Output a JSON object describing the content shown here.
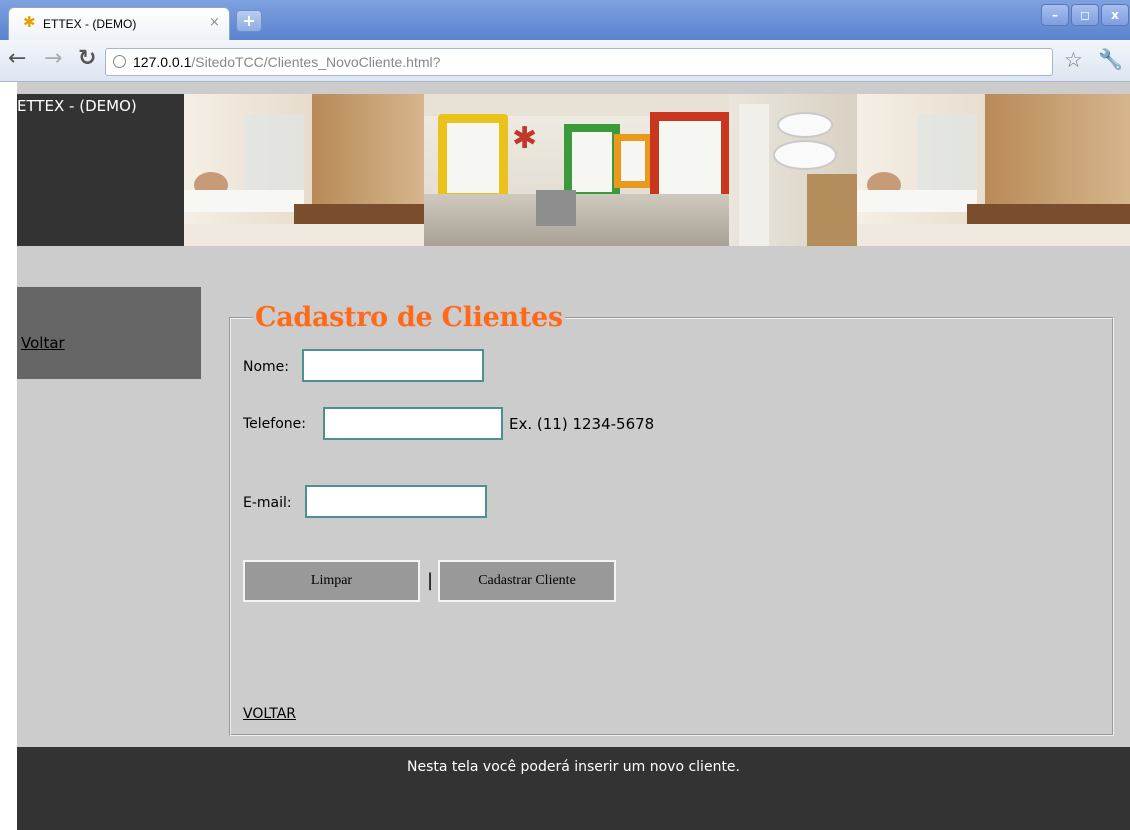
{
  "browser": {
    "tab_title": "ETTEX - (DEMO)",
    "tab_close": "×",
    "new_tab": "+",
    "window_buttons": [
      "–",
      "◻",
      "x"
    ],
    "url_host": "127.0.0.1",
    "url_path": "/SitedoTCC/Clientes_NovoCliente.html?",
    "icons": [
      "back-arrow-icon",
      "forward-arrow-icon",
      "reload-icon",
      "page-info-icon",
      "bookmark-star-icon",
      "wrench-icon"
    ]
  },
  "header": {
    "logo_text": "ETTEX - (DEMO)"
  },
  "sidebar": {
    "link_label": "Voltar"
  },
  "form": {
    "legend": "Cadastro de Clientes",
    "nome_label": "Nome:",
    "nome_value": "",
    "telefone_label": "Telefone:",
    "telefone_value": "",
    "telefone_hint": "Ex. (11) 1234-5678",
    "email_label": "E-mail:",
    "email_value": "",
    "limpar_label": "Limpar",
    "separator": "|",
    "cadastrar_label": "Cadastrar Cliente",
    "voltar_label": "VOLTAR"
  },
  "footer": {
    "text": "Nesta tela você poderá inserir um novo cliente."
  },
  "colors": {
    "page_bg": "#cccccc",
    "dark_bg": "#333333",
    "sidebar_bg": "#666666",
    "legend": "#ff6a1a",
    "input_border": "#4e8f8f",
    "button_bg": "#999999"
  }
}
